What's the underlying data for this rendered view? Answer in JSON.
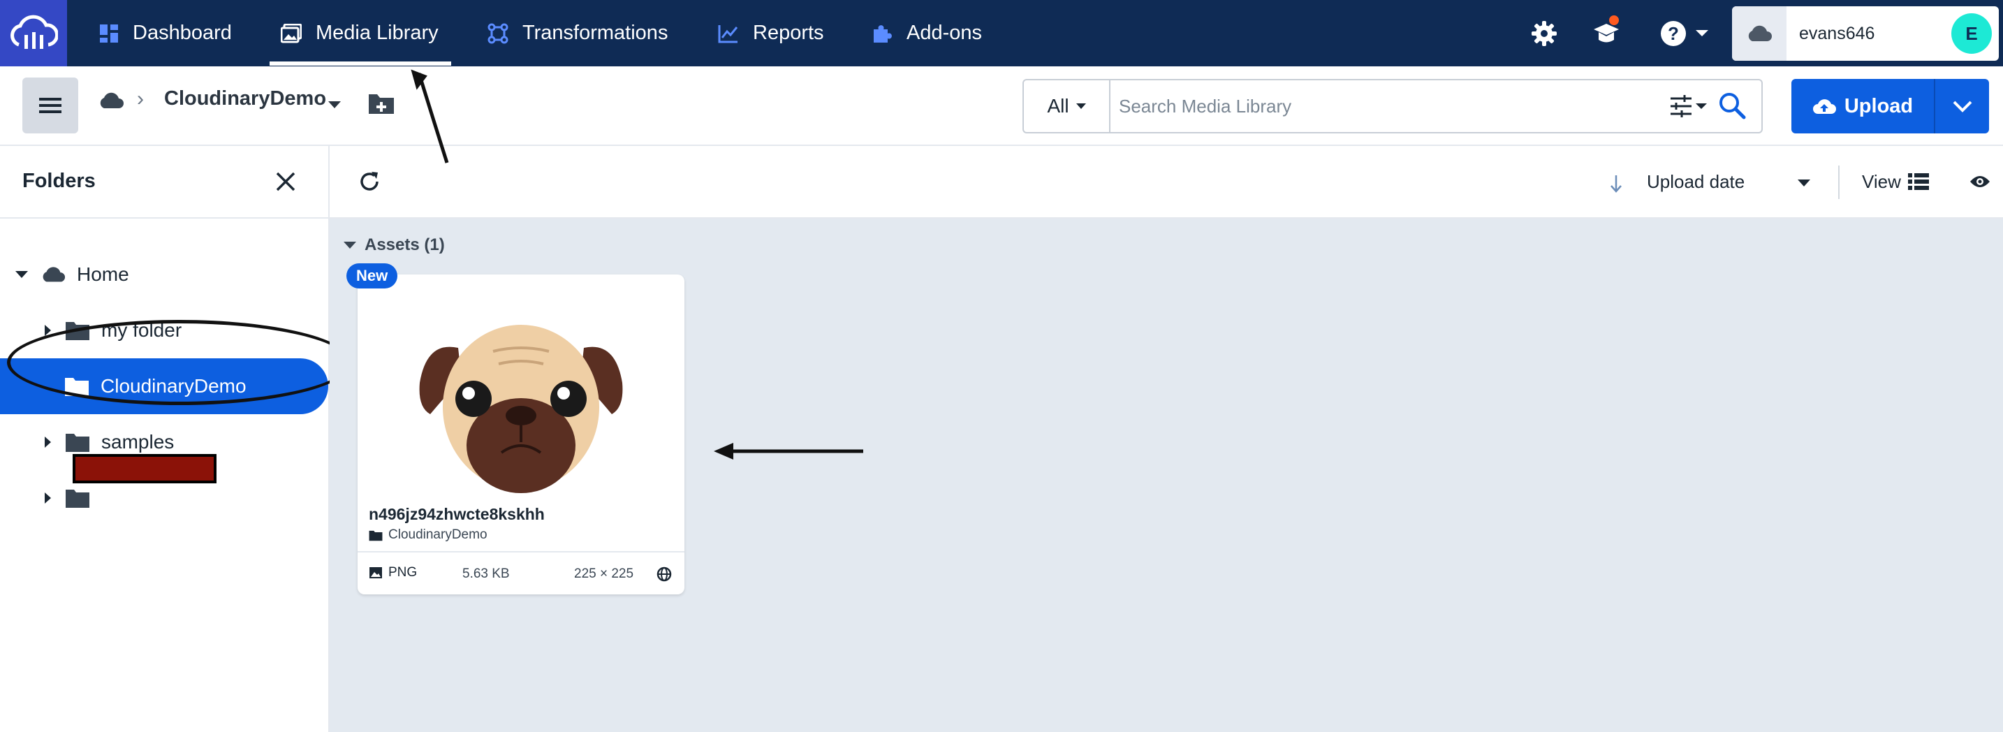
{
  "nav": {
    "items": [
      {
        "label": "Dashboard",
        "icon": "dashboard-icon"
      },
      {
        "label": "Media Library",
        "icon": "media-library-icon",
        "active": true
      },
      {
        "label": "Transformations",
        "icon": "transformations-icon"
      },
      {
        "label": "Reports",
        "icon": "reports-icon"
      },
      {
        "label": "Add-ons",
        "icon": "puzzle-icon"
      }
    ],
    "username": "evans646",
    "avatar_initial": "E",
    "colors": {
      "bar": "#0f2b55",
      "logo_bg": "#3448c5",
      "accent": "#0d5fe0",
      "avatar": "#1de9d5",
      "notification": "#ff5a1f"
    }
  },
  "breadcrumb": {
    "current": "CloudinaryDemo"
  },
  "search": {
    "type": "All",
    "placeholder": "Search Media Library"
  },
  "upload": {
    "label": "Upload"
  },
  "folders": {
    "title": "Folders",
    "tree": [
      {
        "label": "Home",
        "level": 0,
        "expanded": true
      },
      {
        "label": "my folder",
        "level": 1
      },
      {
        "label": "CloudinaryDemo",
        "level": 1,
        "selected": true
      },
      {
        "label": "samples",
        "level": 1
      },
      {
        "label": "",
        "level": 1,
        "redacted": true
      }
    ]
  },
  "sort": {
    "label": "Upload date",
    "direction": "descending"
  },
  "view": {
    "label": "View",
    "mode": "list"
  },
  "assets": {
    "header": "Assets (1)",
    "items": [
      {
        "badge": "New",
        "name": "n496jz94zhwcte8kskhh",
        "folder": "CloudinaryDemo",
        "format": "PNG",
        "size": "5.63 KB",
        "dimensions": "225 × 225"
      }
    ]
  }
}
